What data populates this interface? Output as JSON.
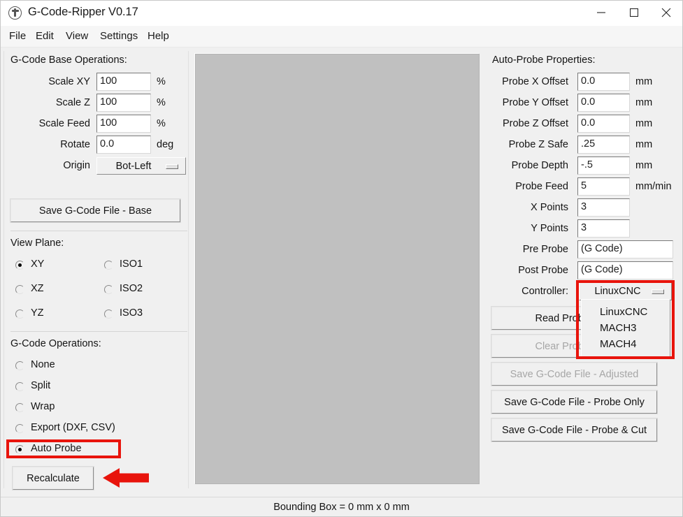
{
  "window": {
    "title": "G-Code-Ripper V0.17",
    "icon": "app-logo-icon",
    "minimize": "minimize-icon",
    "maximize": "maximize-icon",
    "close": "close-icon"
  },
  "menubar": {
    "items": [
      "File",
      "Edit",
      "View",
      "Settings",
      "Help"
    ]
  },
  "left_panel": {
    "base_ops_title": "G-Code Base Operations:",
    "fields": [
      {
        "label": "Scale XY",
        "value": "100",
        "unit": "%"
      },
      {
        "label": "Scale Z",
        "value": "100",
        "unit": "%"
      },
      {
        "label": "Scale Feed",
        "value": "100",
        "unit": "%"
      },
      {
        "label": "Rotate",
        "value": "0.0",
        "unit": "deg"
      }
    ],
    "origin_label": "Origin",
    "origin_value": "Bot-Left",
    "save_base_button": "Save G-Code File - Base",
    "view_plane_title": "View Plane:",
    "view_plane_options": [
      {
        "label": "XY",
        "selected": true
      },
      {
        "label": "XZ",
        "selected": false
      },
      {
        "label": "YZ",
        "selected": false
      },
      {
        "label": "ISO1",
        "selected": false
      },
      {
        "label": "ISO2",
        "selected": false
      },
      {
        "label": "ISO3",
        "selected": false
      }
    ],
    "gcode_ops_title": "G-Code Operations:",
    "gcode_ops_options": [
      {
        "label": "None",
        "selected": false
      },
      {
        "label": "Split",
        "selected": false
      },
      {
        "label": "Wrap",
        "selected": false
      },
      {
        "label": "Export (DXF, CSV)",
        "selected": false
      },
      {
        "label": "Auto Probe",
        "selected": true
      }
    ],
    "recalculate_button": "Recalculate"
  },
  "right_panel": {
    "title": "Auto-Probe Properties:",
    "fields": [
      {
        "label": "Probe X Offset",
        "value": "0.0",
        "unit": "mm"
      },
      {
        "label": "Probe Y Offset",
        "value": "0.0",
        "unit": "mm"
      },
      {
        "label": "Probe Z Offset",
        "value": "0.0",
        "unit": "mm"
      },
      {
        "label": "Probe Z Safe",
        "value": ".25",
        "unit": "mm"
      },
      {
        "label": "Probe Depth",
        "value": "-.5",
        "unit": "mm"
      },
      {
        "label": "Probe Feed",
        "value": "5",
        "unit": "mm/min"
      },
      {
        "label": "X Points",
        "value": "3",
        "unit": ""
      },
      {
        "label": "Y Points",
        "value": "3",
        "unit": ""
      }
    ],
    "wide_fields": [
      {
        "label": "Pre Probe",
        "value": "(G Code)"
      },
      {
        "label": "Post Probe",
        "value": "(G Code)"
      }
    ],
    "controller_label": "Controller:",
    "controller_value": "LinuxCNC",
    "controller_options": [
      "LinuxCNC",
      "MACH3",
      "MACH4"
    ],
    "buttons": [
      {
        "label": "Read Probe Data",
        "enabled": true
      },
      {
        "label": "Clear Probe Data",
        "enabled": false
      },
      {
        "label": "Save G-Code File - Adjusted",
        "enabled": false
      },
      {
        "label": "Save G-Code File - Probe Only",
        "enabled": true
      },
      {
        "label": "Save G-Code File - Probe & Cut",
        "enabled": true
      }
    ]
  },
  "statusbar": {
    "text": "Bounding Box = 0 mm  x 0 mm"
  },
  "annotations": {
    "highlight_color": "#e8140c",
    "arrow": "left-pointing-arrow"
  }
}
